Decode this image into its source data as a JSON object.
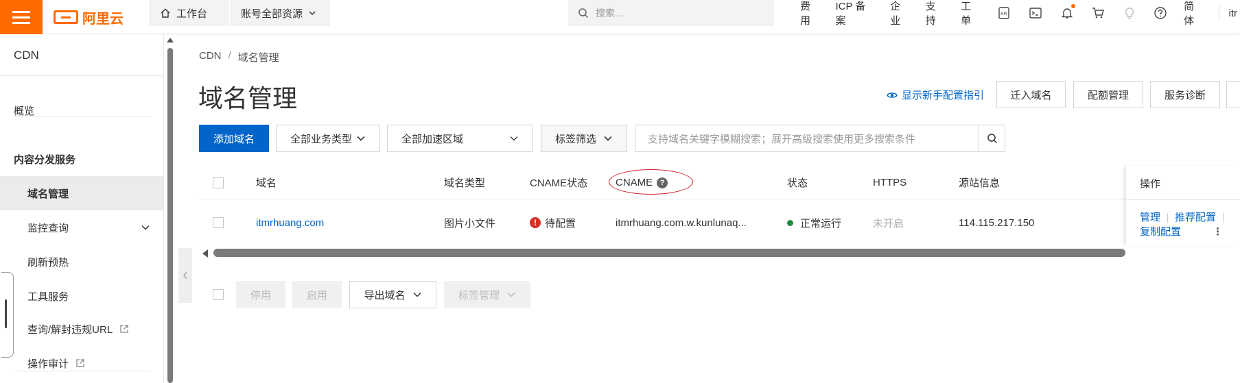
{
  "topbar": {
    "logo_text": "阿里云",
    "workbench": "工作台",
    "resource_scope": "账号全部资源",
    "search_placeholder": "搜索...",
    "links": [
      "费用",
      "ICP 备案",
      "企业",
      "支持",
      "工单"
    ],
    "lang": "简体",
    "user": "itr",
    "accent_color": "#ff6a00"
  },
  "sidebar": {
    "title": "CDN",
    "overview": "概览",
    "group": "内容分发服务",
    "items": [
      {
        "label": "域名管理",
        "active": true
      },
      {
        "label": "监控查询",
        "expandable": true
      },
      {
        "label": "刷新预热"
      },
      {
        "label": "工具服务"
      },
      {
        "label": "查询/解封违规URL",
        "external": true
      },
      {
        "label": "操作审计",
        "external": true
      }
    ]
  },
  "breadcrumb": {
    "root": "CDN",
    "sep": "/",
    "current": "域名管理"
  },
  "page": {
    "title": "域名管理",
    "guide_link": "显示新手配置指引",
    "header_buttons": [
      "迁入域名",
      "配额管理",
      "服务诊断"
    ],
    "primary_color": "#0064c8"
  },
  "toolbar": {
    "add_domain": "添加域名",
    "biz_type": "全部业务类型",
    "accel_region": "全部加速区域",
    "tag_filter": "标签筛选",
    "search_placeholder": "支持域名关键字模糊搜索；展开高级搜索使用更多搜索条件"
  },
  "table": {
    "columns": [
      "域名",
      "域名类型",
      "CNAME状态",
      "CNAME",
      "状态",
      "HTTPS",
      "源站信息",
      "操作"
    ],
    "rows": [
      {
        "domain": "itmrhuang.com",
        "type": "图片小文件",
        "cname_status": "待配置",
        "cname": "itmrhuang.com.w.kunlunaq...",
        "status": "正常运行",
        "https": "未开启",
        "origin": "114.115.217.150",
        "ops": [
          "管理",
          "推荐配置",
          "复制配置"
        ]
      }
    ]
  },
  "bottom": {
    "disable": "停用",
    "enable": "启用",
    "export": "导出域名",
    "tag_manage": "标签管理"
  }
}
